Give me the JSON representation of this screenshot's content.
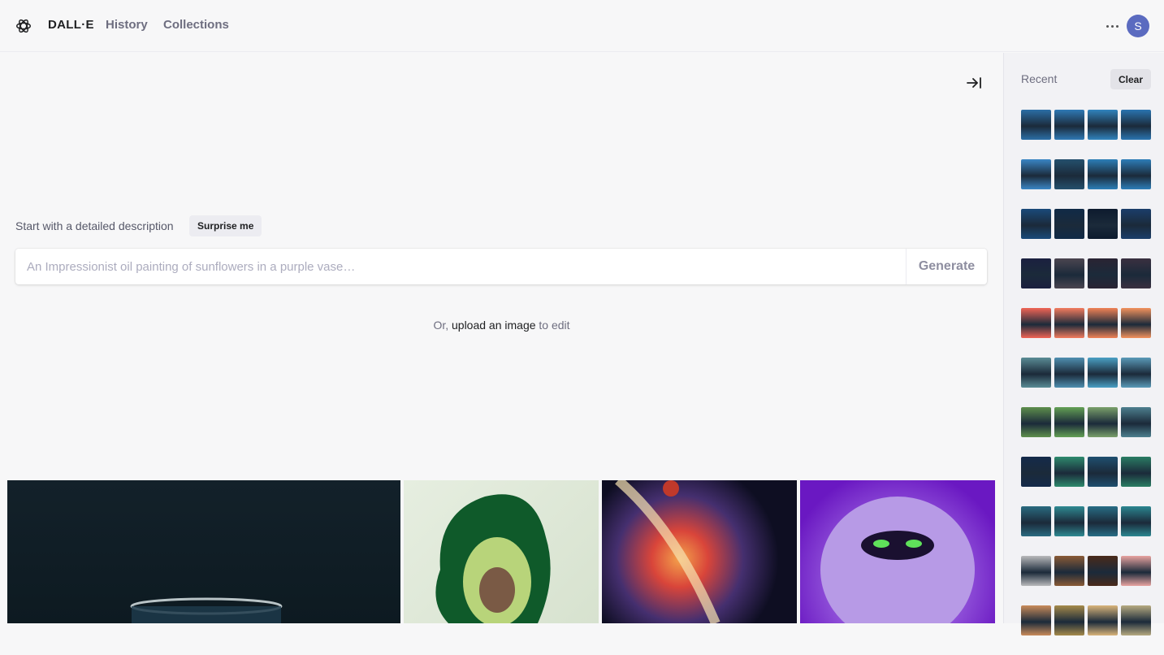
{
  "header": {
    "brand": "DALL·E",
    "nav": [
      "History",
      "Collections"
    ],
    "avatar_initial": "S"
  },
  "main": {
    "prompt_label": "Start with a detailed description",
    "surprise_label": "Surprise me",
    "prompt_placeholder": "An Impressionist oil painting of sunflowers in a purple vase…",
    "generate_label": "Generate",
    "upload_prefix": "Or,",
    "upload_link": "upload an image",
    "upload_suffix": "to edit"
  },
  "sidebar": {
    "recent_label": "Recent",
    "clear_label": "Clear",
    "thumbnail_rows": [
      [
        "#2b6ea6",
        "#2f79b5",
        "#3184bd",
        "#2a74b0"
      ],
      [
        "#3a86c5",
        "#24506d",
        "#2c7fb7",
        "#2d7db8"
      ],
      [
        "#1a4a7a",
        "#102a47",
        "#0d1b2e",
        "#1b3e6a"
      ],
      [
        "#1b2040",
        "#4b4550",
        "#2a2433",
        "#3a3040"
      ],
      [
        "#f06455",
        "#f27b5e",
        "#f08256",
        "#f2925d"
      ],
      [
        "#5a8c95",
        "#4f8fb0",
        "#4aa0c4",
        "#5a9ab8"
      ],
      [
        "#5e8f4c",
        "#63a054",
        "#7aa06a",
        "#4d7f8e"
      ],
      [
        "#142a4a",
        "#2e8a6d",
        "#1f4f6f",
        "#2a7d63"
      ],
      [
        "#2a6b80",
        "#2f8a92",
        "#286d85",
        "#2b8690"
      ],
      [
        "#b9b9bb",
        "#8a5a36",
        "#4a2a1a",
        "#e8a3a0"
      ],
      [
        "#c98b5a",
        "#a58a4a",
        "#d9b47a",
        "#b6aa80"
      ]
    ]
  }
}
